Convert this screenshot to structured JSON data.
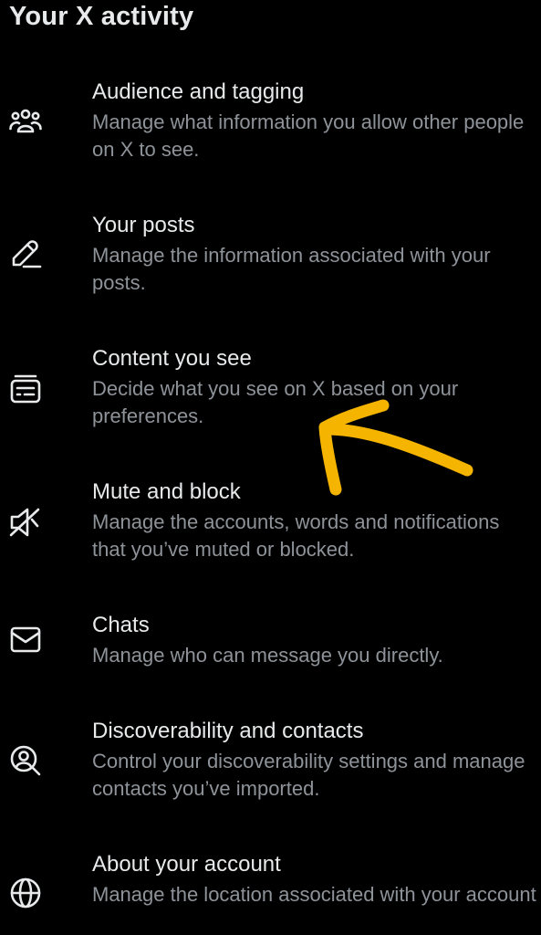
{
  "header": {
    "title": "Your X activity"
  },
  "items": [
    {
      "title": "Audience and tagging",
      "description": "Manage what information you allow other people on X to see.",
      "icon": "people-icon"
    },
    {
      "title": "Your posts",
      "description": "Manage the information associated with your posts.",
      "icon": "pencil-icon"
    },
    {
      "title": "Content you see",
      "description": "Decide what you see on X based on your preferences.",
      "icon": "content-card-icon"
    },
    {
      "title": "Mute and block",
      "description": "Manage the accounts, words and notifications that you’ve muted or blocked.",
      "icon": "muted-speaker-icon"
    },
    {
      "title": "Chats",
      "description": "Manage who can message you directly.",
      "icon": "envelope-icon"
    },
    {
      "title": "Discoverability and contacts",
      "description": "Control your discoverability settings and manage contacts you’ve imported.",
      "icon": "person-search-icon"
    },
    {
      "title": "About your account",
      "description": "Manage the location associated with your account",
      "icon": "globe-icon"
    }
  ],
  "colors": {
    "background": "#000000",
    "primary_text": "#e7e9ea",
    "secondary_text": "#8e9399",
    "annotation": "#f4b400"
  }
}
